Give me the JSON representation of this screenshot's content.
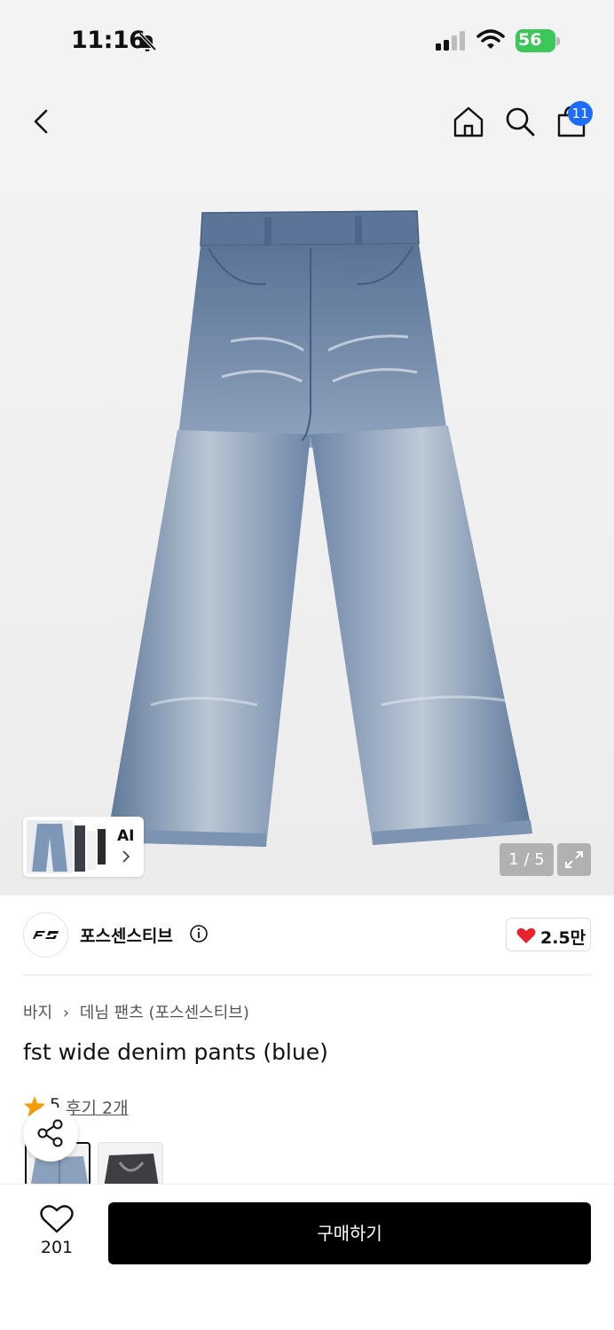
{
  "status_bar": {
    "time": "11:16",
    "battery": "56",
    "icons": [
      "bell-muted-icon",
      "cellular-signal-icon",
      "wifi-icon",
      "battery-charging-icon"
    ]
  },
  "nav": {
    "back_icon": "chevron-left-icon",
    "home_icon": "home-icon",
    "search_icon": "search-icon",
    "cart_icon": "shopping-bag-icon",
    "cart_badge": "11"
  },
  "gallery": {
    "counter": "1 / 5",
    "thumb_label": "AI",
    "expand_icon": "expand-icon"
  },
  "brand": {
    "name": "포스센스티브",
    "likes": "2.5만"
  },
  "product": {
    "breadcrumb": [
      "바지",
      "데님 팬츠 (포스센스티브)"
    ],
    "title": "fst wide denim pants (blue)",
    "rating": "5",
    "reviews": "후기 2개"
  },
  "bottom": {
    "wish_count": "201",
    "buy_label": "구매하기"
  },
  "colors": {
    "accent": "#1e6bff",
    "heart": "#e8232b",
    "star": "#f59e0b",
    "buy_bg": "#000000",
    "denim": "#7b93b3"
  }
}
